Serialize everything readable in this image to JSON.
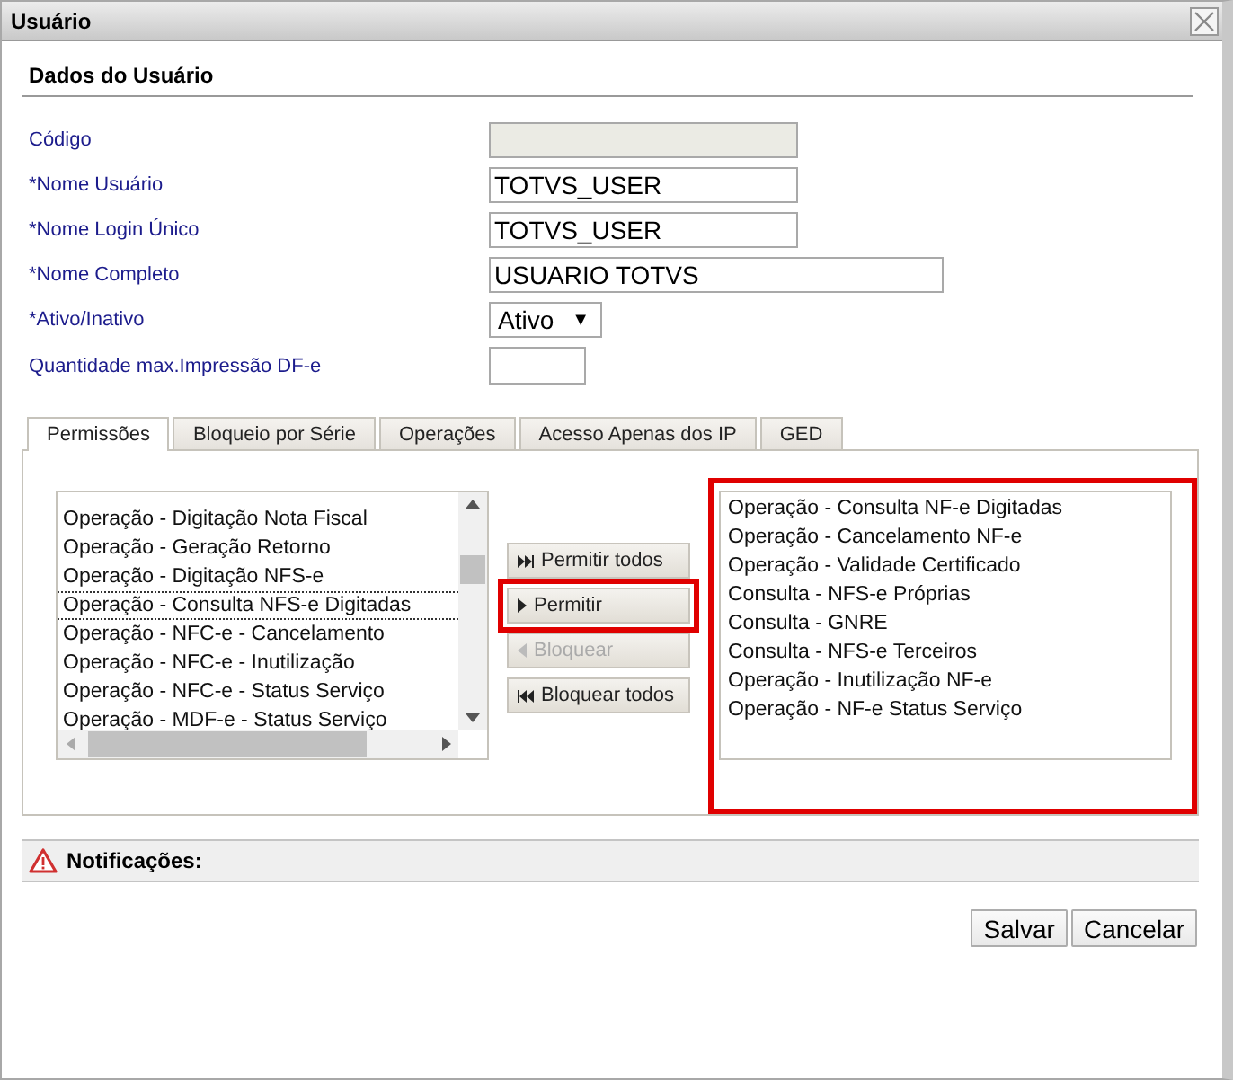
{
  "window": {
    "title": "Usuário"
  },
  "section": {
    "title": "Dados do Usuário"
  },
  "fields": [
    {
      "kind": "text",
      "label": "Código",
      "disabled": true
    },
    {
      "kind": "text",
      "label": "*Nome Usuário",
      "value": "TOTVS_USER",
      "disabled": false
    },
    {
      "kind": "text",
      "label": "*Nome Login Único",
      "value": "TOTVS_USER",
      "disabled": false
    },
    {
      "kind": "wide",
      "label": "*Nome Completo",
      "value": "USUARIO TOTVS",
      "disabled": false
    },
    {
      "kind": "select",
      "label": "*Ativo/Inativo",
      "value": "Ativo",
      "caret": "▼"
    },
    {
      "kind": "number",
      "label": "Quantidade max.Impressão DF-e",
      "disabled": false
    }
  ],
  "tabs": [
    {
      "label": "Permissões",
      "selected": true
    },
    {
      "label": "Bloqueio por Série",
      "selected": false
    },
    {
      "label": "Operações",
      "selected": false
    },
    {
      "label": "Acesso Apenas dos IP",
      "selected": false
    },
    {
      "label": "GED",
      "selected": false
    }
  ],
  "available": {
    "items": [
      {
        "label": "Operação - Digitação Nota Fiscal",
        "selected": false
      },
      {
        "label": "Operação - Geração Retorno",
        "selected": false
      },
      {
        "label": "Operação - Digitação NFS-e",
        "selected": false
      },
      {
        "label": "Operação - Consulta NFS-e Digitadas",
        "selected": true
      },
      {
        "label": "Operação - NFC-e - Cancelamento",
        "selected": false
      },
      {
        "label": "Operação - NFC-e - Inutilização",
        "selected": false
      },
      {
        "label": "Operação - NFC-e - Status Serviço",
        "selected": false
      },
      {
        "label": "Operação - MDF-e - Status Serviço",
        "selected": false
      }
    ]
  },
  "transfer_buttons": [
    {
      "label": "Permitir todos",
      "kind": "all-right",
      "disabled": false,
      "highlighted": false
    },
    {
      "label": "Permitir",
      "kind": "right",
      "disabled": false,
      "highlighted": true
    },
    {
      "label": "Bloquear",
      "kind": "left",
      "disabled": true,
      "highlighted": false
    },
    {
      "label": "Bloquear todos",
      "kind": "all-left",
      "disabled": false,
      "highlighted": false
    }
  ],
  "allowed": {
    "highlighted": true,
    "items": [
      {
        "label": "Operação - Consulta NF-e Digitadas"
      },
      {
        "label": "Operação - Cancelamento NF-e"
      },
      {
        "label": "Operação - Validade Certificado"
      },
      {
        "label": "Consulta - NFS-e Próprias"
      },
      {
        "label": "Consulta - GNRE"
      },
      {
        "label": "Consulta - NFS-e Terceiros"
      },
      {
        "label": "Operação - Inutilização NF-e"
      },
      {
        "label": "Operação - NF-e Status Serviço"
      }
    ]
  },
  "notifications": {
    "title": "Notificações:"
  },
  "buttons": [
    {
      "label": "Salvar"
    },
    {
      "label": "Cancelar"
    }
  ]
}
